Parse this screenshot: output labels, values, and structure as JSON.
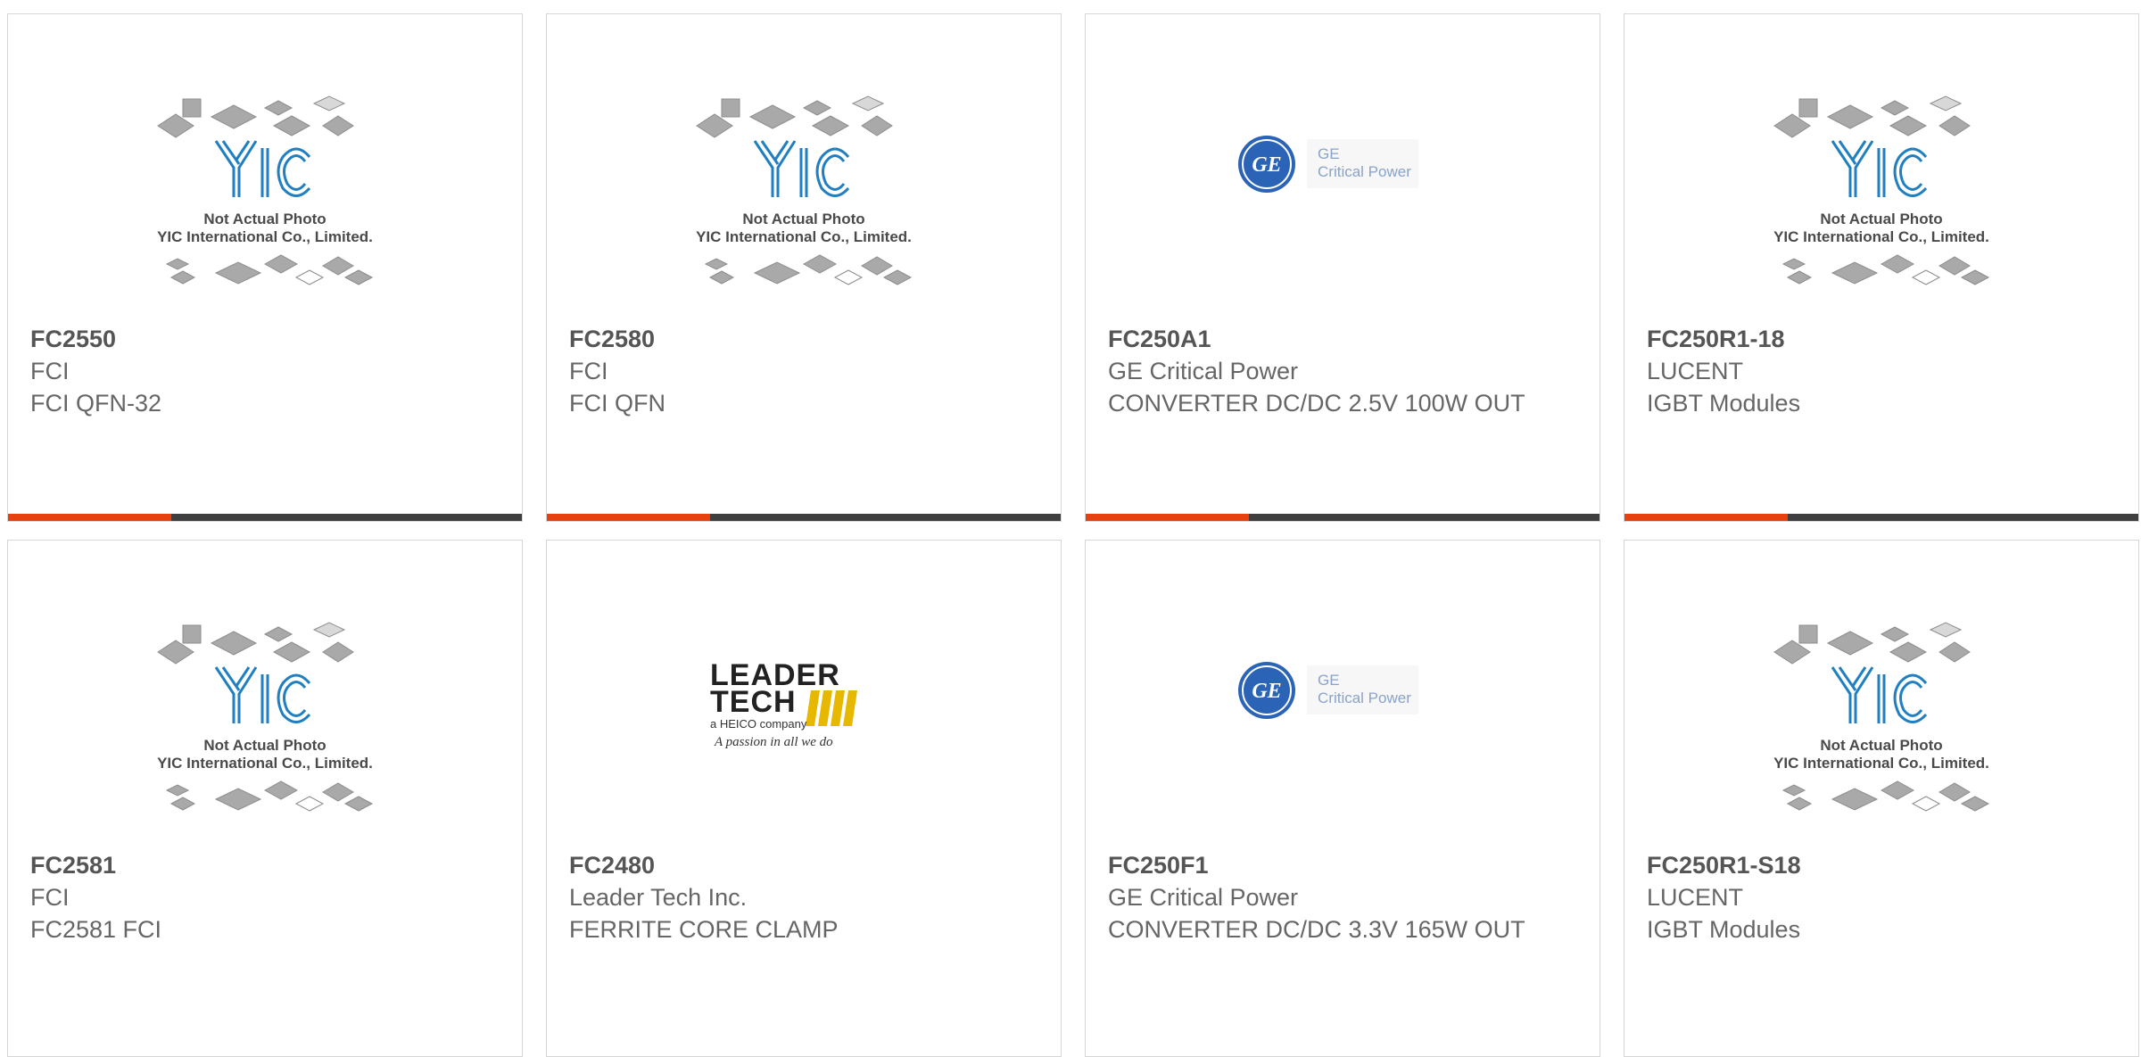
{
  "products": [
    {
      "part": "FC2550",
      "maker": "FCI",
      "desc": "FCI QFN-32",
      "image": "yic-placeholder"
    },
    {
      "part": "FC2580",
      "maker": "FCI",
      "desc": "FCI QFN",
      "image": "yic-placeholder"
    },
    {
      "part": "FC250A1",
      "maker": "GE Critical Power",
      "desc": "CONVERTER DC/DC 2.5V 100W OUT",
      "image": "ge-logo"
    },
    {
      "part": "FC250R1-18",
      "maker": "LUCENT",
      "desc": "IGBT Modules",
      "image": "yic-placeholder"
    },
    {
      "part": "FC2581",
      "maker": "FCI",
      "desc": "FC2581 FCI",
      "image": "yic-placeholder"
    },
    {
      "part": "FC2480",
      "maker": "Leader Tech Inc.",
      "desc": "FERRITE CORE CLAMP",
      "image": "leader-tech-logo"
    },
    {
      "part": "FC250F1",
      "maker": "GE Critical Power",
      "desc": "CONVERTER DC/DC 3.3V 165W OUT",
      "image": "ge-logo"
    },
    {
      "part": "FC250R1-S18",
      "maker": "LUCENT",
      "desc": "IGBT Modules",
      "image": "yic-placeholder"
    }
  ],
  "placeholder": {
    "line1": "Not Actual Photo",
    "line2": "YIC International Co., Limited.",
    "brand": "YIC"
  },
  "ge": {
    "top": "GE",
    "bottom": "Critical Power",
    "mark": "GE"
  },
  "leader": {
    "line1": "LEADER",
    "line2": "TECH",
    "line3": "a HEICO company",
    "line4": "A passion in all we do"
  },
  "colors": {
    "accent": "#e6410f",
    "bar": "#3f3f3f",
    "border": "#d6d6d6",
    "yic_blue": "#1f7fc1"
  }
}
